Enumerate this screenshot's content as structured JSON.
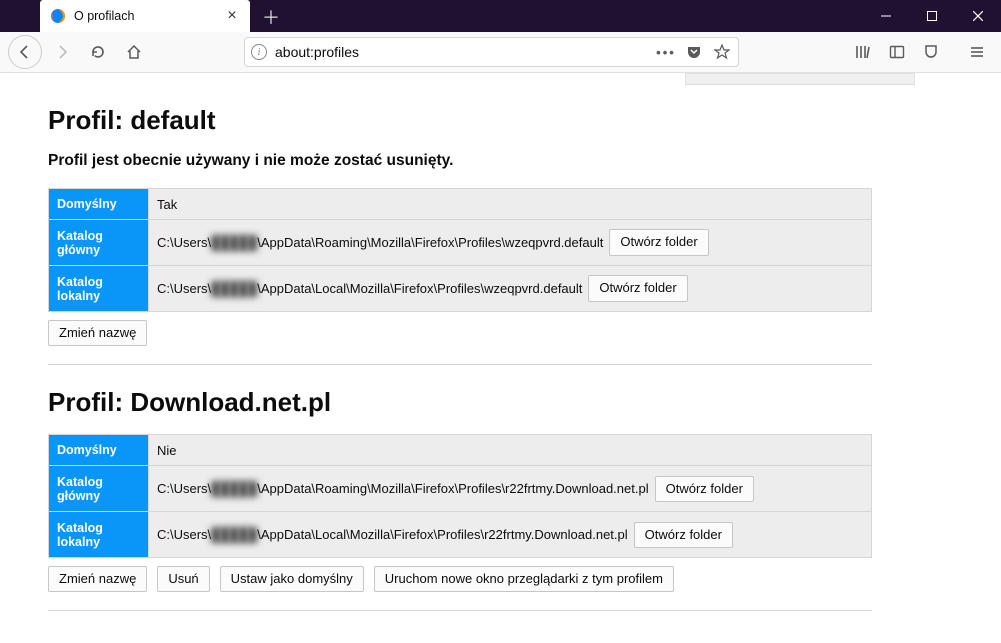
{
  "window": {
    "tab_title": "O profilach",
    "url": "about:profiles"
  },
  "profiles": [
    {
      "title": "Profil: default",
      "in_use_text": "Profil jest obecnie używany i nie może zostać usunięty.",
      "rows": {
        "default_label": "Domyślny",
        "default_value": "Tak",
        "rootdir_label": "Katalog główny",
        "rootdir_path_pre": "C:\\Users\\",
        "rootdir_path_blur": "█████",
        "rootdir_path_post": "\\AppData\\Roaming\\Mozilla\\Firefox\\Profiles\\wzeqpvrd.default",
        "localdir_label": "Katalog lokalny",
        "localdir_path_pre": "C:\\Users\\",
        "localdir_path_blur": "█████",
        "localdir_path_post": "\\AppData\\Local\\Mozilla\\Firefox\\Profiles\\wzeqpvrd.default",
        "open_folder": "Otwórz folder"
      },
      "buttons": {
        "rename": "Zmień nazwę"
      }
    },
    {
      "title": "Profil: Download.net.pl",
      "rows": {
        "default_label": "Domyślny",
        "default_value": "Nie",
        "rootdir_label": "Katalog główny",
        "rootdir_path_pre": "C:\\Users\\",
        "rootdir_path_blur": "█████",
        "rootdir_path_post": "\\AppData\\Roaming\\Mozilla\\Firefox\\Profiles\\r22frtmy.Download.net.pl",
        "localdir_label": "Katalog lokalny",
        "localdir_path_pre": "C:\\Users\\",
        "localdir_path_blur": "█████",
        "localdir_path_post": "\\AppData\\Local\\Mozilla\\Firefox\\Profiles\\r22frtmy.Download.net.pl",
        "open_folder": "Otwórz folder"
      },
      "buttons": {
        "rename": "Zmień nazwę",
        "delete": "Usuń",
        "set_default": "Ustaw jako domyślny",
        "launch": "Uruchom nowe okno przeglądarki z tym profilem"
      }
    }
  ]
}
